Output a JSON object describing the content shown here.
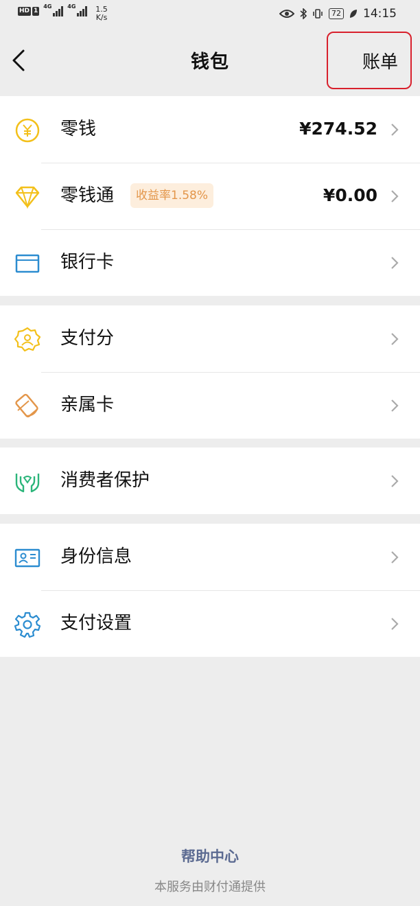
{
  "status_bar": {
    "hd": "HD",
    "sim": "1",
    "network1": "4G",
    "network2": "4G",
    "speed_value": "1.5",
    "speed_unit": "K/s",
    "battery": "72",
    "time": "14:15"
  },
  "nav": {
    "title": "钱包",
    "bill_label": "账单"
  },
  "groups": [
    {
      "items": [
        {
          "label": "零钱",
          "value": "¥274.52",
          "icon": "yuan-coin-icon"
        },
        {
          "label": "零钱通",
          "value": "¥0.00",
          "badge": "收益率1.58%",
          "icon": "diamond-icon"
        },
        {
          "label": "银行卡",
          "value": "",
          "icon": "bank-card-icon"
        }
      ]
    },
    {
      "items": [
        {
          "label": "支付分",
          "icon": "pay-score-icon"
        },
        {
          "label": "亲属卡",
          "icon": "family-card-icon"
        }
      ]
    },
    {
      "items": [
        {
          "label": "消费者保护",
          "icon": "consumer-protection-icon"
        }
      ]
    },
    {
      "items": [
        {
          "label": "身份信息",
          "icon": "id-card-icon"
        },
        {
          "label": "支付设置",
          "icon": "settings-gear-icon"
        }
      ]
    }
  ],
  "footer": {
    "help_center": "帮助中心",
    "provider_note": "本服务由财付通提供"
  },
  "colors": {
    "background": "#ededed",
    "highlight_border": "#d8202c",
    "badge_bg": "#fdeedd",
    "badge_text": "#e3964a",
    "link": "#5b6a91"
  }
}
